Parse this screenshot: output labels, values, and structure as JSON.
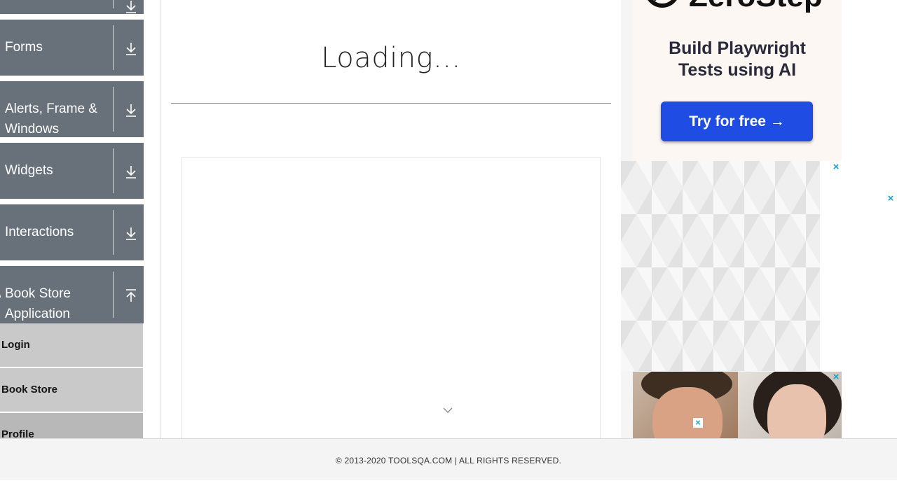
{
  "sidebar": {
    "groups": [
      {
        "label": "",
        "icon": "download-arrow-icon"
      },
      {
        "label": "Forms",
        "icon": "download-arrow-icon"
      },
      {
        "label": "Alerts, Frame &",
        "label2": "Windows",
        "icon": "download-arrow-icon"
      },
      {
        "label": "Widgets",
        "icon": "download-arrow-icon"
      },
      {
        "label": "Interactions",
        "icon": "download-arrow-icon"
      },
      {
        "label": "Book Store",
        "label2": "Application",
        "icon": "upload-arrow-icon"
      }
    ],
    "items": [
      {
        "label": "Login"
      },
      {
        "label": "Book Store"
      },
      {
        "label": "Profile"
      }
    ]
  },
  "main": {
    "title": "Loading..."
  },
  "ads": {
    "top": {
      "brand": "ZeroStep",
      "headline_line1": "Build Playwright",
      "headline_line2": "Tests using AI",
      "cta": "Try for free →"
    },
    "close_glyph": "×"
  },
  "footer": {
    "copyright": "© 2013-2020 TOOLSQA.COM | ALL RIGHTS RESERVED."
  },
  "colors": {
    "sidebar_group_bg": "#687079",
    "sidebar_item_bg": "#c9c9c9",
    "cta_blue": "#1f4de4",
    "close_teal": "#1aa3c7"
  }
}
